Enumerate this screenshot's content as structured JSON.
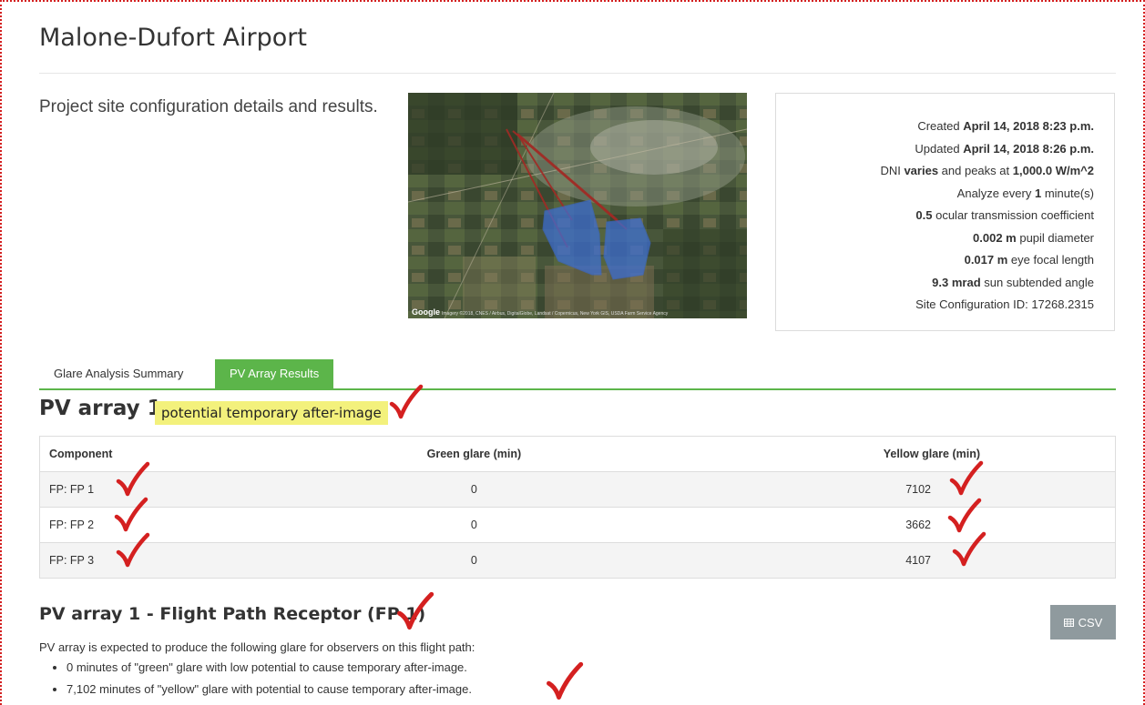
{
  "page": {
    "title": "Malone-Dufort Airport"
  },
  "site": {
    "description": "Project site configuration details and results."
  },
  "map": {
    "credit_logo": "Google",
    "credit_text": "Imagery ©2018, CNES / Airbus, DigitalGlobe, Landsat / Copernicus, New York GIS, USDA Farm Service Agency"
  },
  "info": {
    "created_label": "Created",
    "created_value": "April 14, 2018 8:23 p.m.",
    "updated_label": "Updated",
    "updated_value": "April 14, 2018 8:26 p.m.",
    "dni_prefix": "DNI",
    "dni_varies": "varies",
    "dni_mid": "and peaks at",
    "dni_peak": "1,000.0 W/m^2",
    "analyze_prefix": "Analyze every",
    "analyze_value": "1",
    "analyze_suffix": "minute(s)",
    "ocular_value": "0.5",
    "ocular_label": "ocular transmission coefficient",
    "pupil_value": "0.002 m",
    "pupil_label": "pupil diameter",
    "focal_value": "0.017 m",
    "focal_label": "eye focal length",
    "sun_value": "9.3 mrad",
    "sun_label": "sun subtended angle",
    "config_id": "Site Configuration ID: 17268.2315"
  },
  "tabs": [
    {
      "label": "Glare Analysis Summary",
      "active": false
    },
    {
      "label": "PV Array Results",
      "active": true
    }
  ],
  "array": {
    "title": "PV array 1",
    "badge": "potential temporary after-image",
    "colors": {
      "badge_bg": "#f3f17c",
      "accent_green": "#5cb54a",
      "check_red": "#d42020"
    }
  },
  "table": {
    "headers": [
      "Component",
      "Green glare (min)",
      "Yellow glare (min)"
    ],
    "rows": [
      {
        "component": "FP: FP 1",
        "green": "0",
        "yellow": "7102"
      },
      {
        "component": "FP: FP 2",
        "green": "0",
        "yellow": "3662"
      },
      {
        "component": "FP: FP 3",
        "green": "0",
        "yellow": "4107"
      }
    ]
  },
  "receptor": {
    "title": "PV array 1 - Flight Path Receptor (FP 1)",
    "csv_label": "CSV",
    "description": "PV array is expected to produce the following glare for observers on this flight path:",
    "bullets": [
      "0 minutes of \"green\" glare with low potential to cause temporary after-image.",
      "7,102 minutes of \"yellow\" glare with potential to cause temporary after-image."
    ]
  }
}
